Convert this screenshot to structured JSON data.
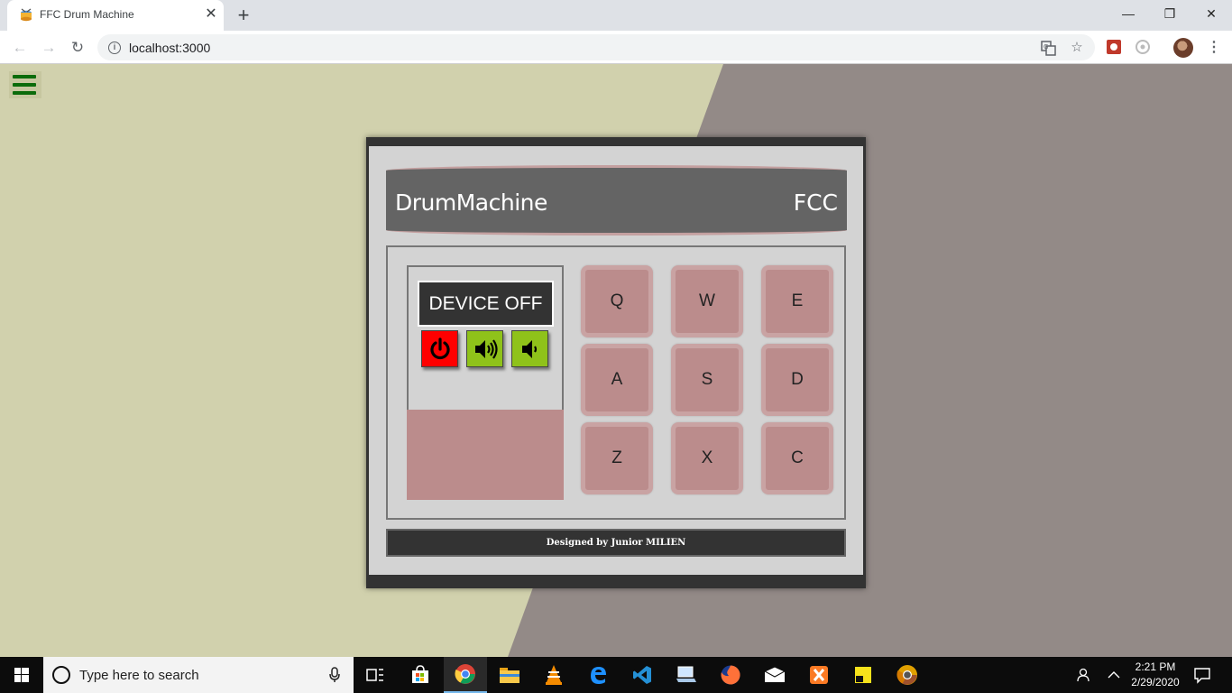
{
  "browser": {
    "tab_title": "FFC Drum Machine",
    "tab_close": "✕",
    "new_tab": "+",
    "url": "localhost:3000",
    "window_minimize": "—",
    "window_restore": "❐",
    "window_close": "✕"
  },
  "app": {
    "header_title": "DrumMachine",
    "header_brand": "FCC",
    "display_text": "DEVICE OFF",
    "controls": [
      {
        "icon": "power-icon",
        "color": "#ff0000"
      },
      {
        "icon": "volume-up-icon",
        "color": "#8fc21a"
      },
      {
        "icon": "volume-down-icon",
        "color": "#8fc21a"
      }
    ],
    "pads": [
      "Q",
      "W",
      "E",
      "A",
      "S",
      "D",
      "Z",
      "X",
      "C"
    ],
    "footer": "Designed by Junior MILIEN",
    "colors": {
      "bg_left": "#d1d1ad",
      "bg_right": "#938a87",
      "pad": "#bb8c8c",
      "pad_border": "#c9a3a3",
      "header": "#646464",
      "hamburger": "#0b6b0b"
    }
  },
  "taskbar": {
    "search_placeholder": "Type here to search",
    "time": "2:21 PM",
    "date": "2/29/2020"
  }
}
